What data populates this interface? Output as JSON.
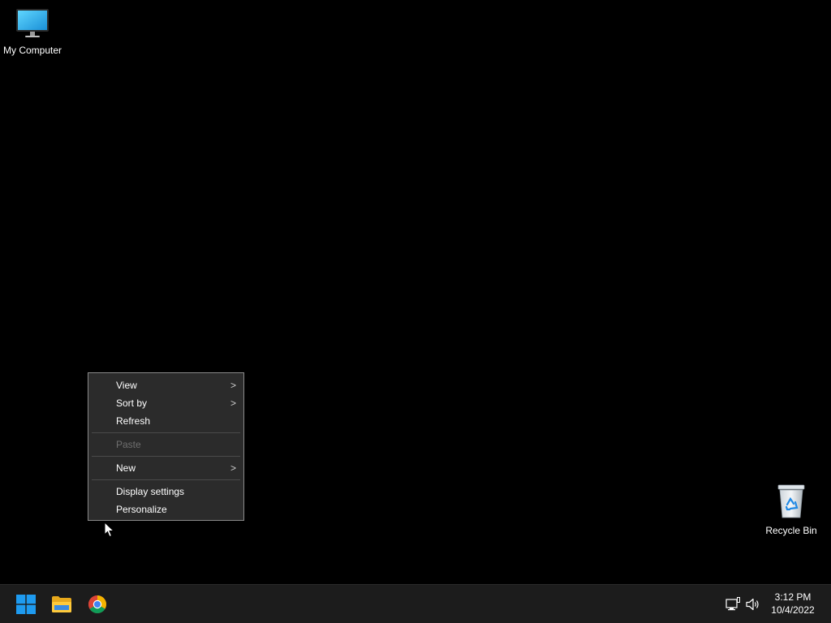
{
  "desktop": {
    "icons": [
      {
        "label": "My Computer",
        "icon": "monitor-icon"
      },
      {
        "label": "Recycle Bin",
        "icon": "recycle-bin-icon"
      }
    ]
  },
  "context_menu": {
    "items": [
      {
        "label": "View",
        "has_submenu": true
      },
      {
        "label": "Sort by",
        "has_submenu": true
      },
      {
        "label": "Refresh"
      },
      {
        "label": "Paste",
        "disabled": true
      },
      {
        "label": "New",
        "has_submenu": true
      },
      {
        "label": "Display settings"
      },
      {
        "label": "Personalize"
      }
    ],
    "submenu_arrow": ">"
  },
  "taskbar": {
    "pinned": [
      {
        "name": "Start",
        "icon": "windows-start-icon"
      },
      {
        "name": "File Explorer",
        "icon": "folder-icon"
      },
      {
        "name": "Google Chrome",
        "icon": "chrome-icon"
      }
    ],
    "tray": {
      "icons": [
        "network-icon",
        "volume-icon"
      ],
      "time": "3:12 PM",
      "date": "10/4/2022"
    }
  },
  "colors": {
    "desktop_background": "#000000",
    "taskbar": "#1c1c1c",
    "menu_background": "#2b2b2b",
    "menu_border": "#8a8a8a",
    "disabled_text": "#6f6f6f",
    "start_blue": "#1e9bf0"
  }
}
